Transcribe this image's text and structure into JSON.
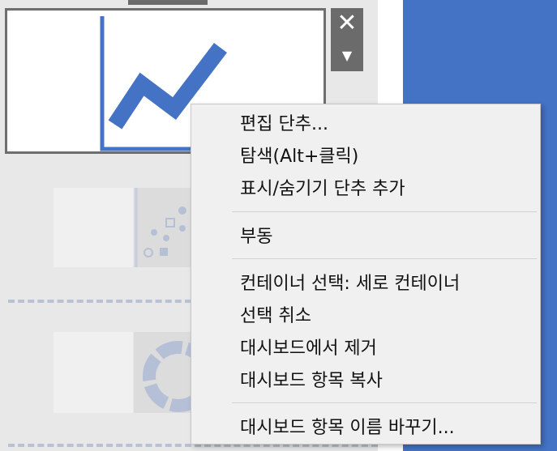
{
  "toolbar": {
    "close_glyph": "✕",
    "dropdown_glyph": "▼"
  },
  "context_menu": {
    "items": [
      {
        "label": "편집 단추..."
      },
      {
        "label": "탐색(Alt+클릭)"
      },
      {
        "label": "표시/숨기기 단추 추가"
      },
      {
        "label": "부동"
      },
      {
        "label": "컨테이너 선택: 세로 컨테이너"
      },
      {
        "label": "선택 취소"
      },
      {
        "label": "대시보드에서 제거"
      },
      {
        "label": "대시보드 항목 복사"
      },
      {
        "label": "대시보드 항목 이름 바꾸기..."
      }
    ]
  },
  "colors": {
    "accent": "#4472c4",
    "toolbar": "#6b6b6b",
    "menu_bg": "#f0f0f0"
  },
  "icons": [
    "line-chart-icon",
    "scatter-chart-icon",
    "donut-chart-icon",
    "close-icon",
    "chevron-down-icon"
  ]
}
